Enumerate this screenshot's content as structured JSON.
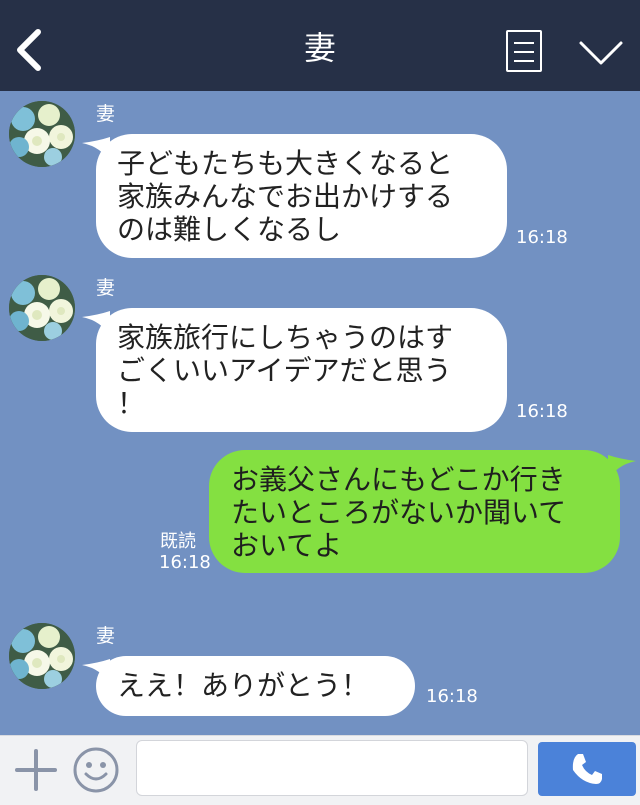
{
  "header": {
    "title": "妻",
    "back_icon": "chevron-left-icon",
    "menu_icon": "menu-icon",
    "dropdown_icon": "chevron-down-icon"
  },
  "messages": [
    {
      "direction": "incoming",
      "sender": "妻",
      "lines": [
        "子どもたちも大きくなると",
        "家族みんなでお出かけする",
        "のは難しくなるし"
      ],
      "time": "16:18"
    },
    {
      "direction": "incoming",
      "sender": "妻",
      "lines": [
        "家族旅行にしちゃうのはす",
        "ごくいいアイデアだと思う",
        "！"
      ],
      "time": "16:18"
    },
    {
      "direction": "outgoing",
      "lines": [
        "お義父さんにもどこか行き",
        "たいところがないか聞いて",
        "おいてよ"
      ],
      "read_label": "既読",
      "time": "16:18"
    },
    {
      "direction": "incoming",
      "sender": "妻",
      "lines": [
        "ええ！ありがとう！"
      ],
      "time": "16:18"
    }
  ],
  "footer": {
    "plus_icon": "plus-icon",
    "emoji_icon": "smile-icon",
    "input_value": "",
    "call_icon": "phone-icon"
  },
  "colors": {
    "header_bg": "#263047",
    "chat_bg": "#7291c2",
    "incoming_bubble": "#ffffff",
    "outgoing_bubble": "#84e041",
    "call_button": "#4b82d9"
  }
}
